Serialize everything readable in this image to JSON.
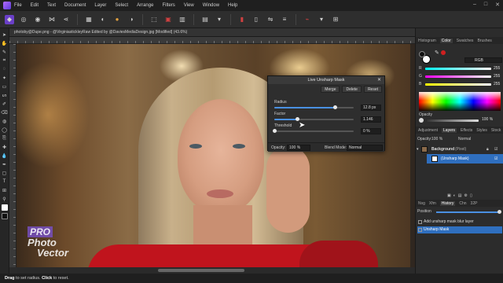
{
  "menu": [
    "File",
    "Edit",
    "Text",
    "Document",
    "Layer",
    "Select",
    "Arrange",
    "Filters",
    "View",
    "Window",
    "Help"
  ],
  "document_title": "photoby@Dupe.png - @VirginiastickleyRaw Edited by @DaviesMediaDesign.jpg [Modified] (43.6%)",
  "dialog": {
    "title": "Live Unsharp Mask",
    "merge": "Merge",
    "delete": "Delete",
    "reset": "Reset",
    "params": [
      {
        "label": "Radius",
        "value": "12.8 px",
        "fraction": 0.77
      },
      {
        "label": "Factor",
        "value": "1.146",
        "fraction": 0.29
      },
      {
        "label": "Threshold",
        "value": "0 %",
        "fraction": 0.0
      }
    ],
    "opacity_label": "Opacity:",
    "opacity_value": "100 %",
    "blend_label": "Blend Mode:",
    "blend_value": "Normal"
  },
  "watermark": {
    "line1": "PRO",
    "line2": "Photo",
    "line3": "Vector"
  },
  "right_panel": {
    "color_tabs": [
      "Histogram",
      "Color",
      "Swatches",
      "Brushes"
    ],
    "color_model": "RGB",
    "channels": [
      {
        "label": "R",
        "value": "255",
        "color": "#ff3030"
      },
      {
        "label": "G",
        "value": "255",
        "color": "#30d030"
      },
      {
        "label": "B",
        "value": "255",
        "color": "#3060ff"
      }
    ],
    "opacity_label": "Opacity",
    "opacity_value": "100 %",
    "layer_tabs": [
      "Adjustment",
      "Layers",
      "Effects",
      "Styles",
      "Stock"
    ],
    "layers_opacity_label": "Opacity:",
    "layers_opacity_value": "100 %",
    "layers_blend_value": "Normal",
    "layers": [
      {
        "name": "Background",
        "type": "(Pixel)"
      },
      {
        "name": "(Unsharp Mask)",
        "type": ""
      }
    ],
    "history_tabs": [
      "Nvg",
      "Xfm",
      "History",
      "Chn",
      "32P"
    ],
    "history_position_label": "Position",
    "history_items": [
      "Add unsharp mask blur layer",
      "Unsharp Mask"
    ]
  },
  "status": {
    "prefix": "Drag",
    "middle": " to set radius. ",
    "click": "Click",
    "suffix": " to reset."
  },
  "colors": {
    "accent": "#4a90e2",
    "selection": "#2f6fbf",
    "shirt": "#c0141d"
  }
}
